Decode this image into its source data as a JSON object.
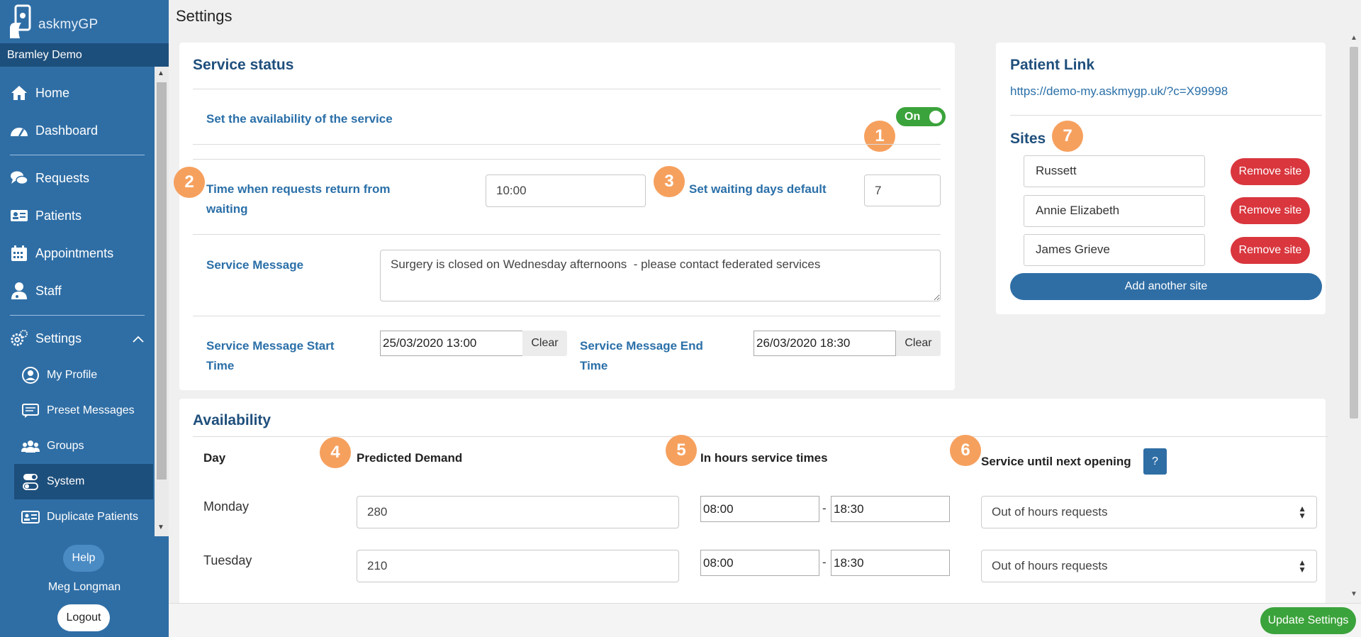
{
  "app": {
    "logo_text": "askmyGP",
    "practice": "Bramley Demo"
  },
  "page": {
    "title": "Settings"
  },
  "nav": {
    "home": "Home",
    "dashboard": "Dashboard",
    "requests": "Requests",
    "patients": "Patients",
    "appointments": "Appointments",
    "staff": "Staff",
    "settings": "Settings",
    "sub": {
      "my_profile": "My Profile",
      "preset_messages": "Preset Messages",
      "groups": "Groups",
      "system": "System",
      "duplicate_patients": "Duplicate Patients"
    },
    "help": "Help",
    "user": "Meg Longman",
    "logout": "Logout"
  },
  "service_status": {
    "title": "Service status",
    "availability_label": "Set the availability of the service",
    "toggle_label": "On",
    "return_time_label": "Time when requests return from waiting",
    "return_time_value": "10:00",
    "waiting_days_label": "Set waiting days default",
    "waiting_days_value": "7",
    "message_label": "Service Message",
    "message_value": "Surgery is closed on Wednesday afternoons  - please contact federated services",
    "start_label": "Service Message Start Time",
    "start_value": "25/03/2020 13:00",
    "end_label": "Service Message End Time",
    "end_value": "26/03/2020 18:30",
    "clear": "Clear"
  },
  "patient_link": {
    "title": "Patient Link",
    "url": "https://demo-my.askmygp.uk/?c=X99998",
    "sites_title": "Sites",
    "sites": [
      "Russett",
      "Annie Elizabeth",
      "James Grieve"
    ],
    "remove_label": "Remove site",
    "add_label": "Add another site"
  },
  "availability": {
    "title": "Availability",
    "headers": {
      "day": "Day",
      "demand": "Predicted Demand",
      "hours": "In hours service times",
      "next": "Service until next opening",
      "help": "?"
    },
    "rows": [
      {
        "day": "Monday",
        "demand": "280",
        "from": "08:00",
        "to": "18:30",
        "next": "Out of hours requests"
      },
      {
        "day": "Tuesday",
        "demand": "210",
        "from": "08:00",
        "to": "18:30",
        "next": "Out of hours requests"
      }
    ],
    "dash": "-"
  },
  "badges": [
    "1",
    "2",
    "3",
    "4",
    "5",
    "6",
    "7"
  ],
  "footer": {
    "update": "Update Settings"
  },
  "colors": {
    "sidebar": "#2f6ea5",
    "sidebar_dark": "#1d4f7c",
    "accent_text": "#2a6fa8",
    "badge": "#f6a05e",
    "danger": "#d9363e",
    "success": "#3ba33b"
  }
}
